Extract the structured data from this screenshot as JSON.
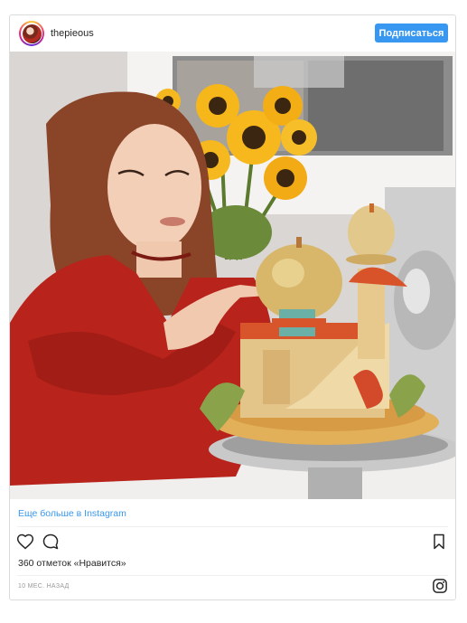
{
  "header": {
    "username": "thepieous",
    "follow_label": "Подписаться"
  },
  "post": {
    "image_alt": "Woman in red dress pointing at an ornate pie-crust castle sculpture with sunflowers behind her"
  },
  "footer": {
    "more_link": "Еще больше в Instagram",
    "likes_text": "360 отметок «Нравится»",
    "time_text": "10 МЕС. НАЗАД"
  },
  "colors": {
    "accent": "#3897f0",
    "text": "#262626",
    "muted": "#999999",
    "border": "#dbdbdb"
  },
  "icons": [
    "heart-icon",
    "comment-icon",
    "bookmark-icon",
    "instagram-icon"
  ]
}
